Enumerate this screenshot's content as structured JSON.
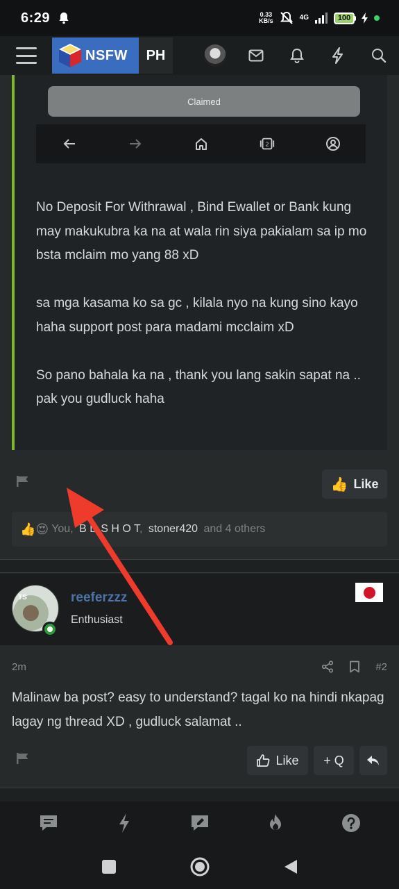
{
  "status_bar": {
    "time": "6:29",
    "net_speed_value": "0.33",
    "net_speed_unit": "KB/s",
    "network": "4G",
    "battery": "100"
  },
  "header": {
    "logo_left": "NSFW",
    "logo_right": "PH",
    "icons": [
      "avatar",
      "mail-icon",
      "bell-icon",
      "bolt-icon",
      "search-icon"
    ]
  },
  "post1": {
    "claimed_button": "Claimed",
    "paragraphs": [
      "No Deposit For Withrawal , Bind Ewallet or Bank kung may makukubra ka na at wala rin siya pakialam sa ip mo bsta mclaim mo yang 88 xD",
      "sa mga kasama ko sa gc , kilala nyo na kung sino kayo haha support post para madami mcclaim xD",
      "So pano bahala ka na , thank you lang sakin sapat na ..",
      "pak you gudluck haha"
    ],
    "like_label": "Like",
    "reactions": {
      "emojis": "👍😍",
      "prefix": "You,",
      "user1": "B  D S H O T",
      "sep": ",",
      "user2": "stoner420",
      "suffix": "and 4 others"
    }
  },
  "post2": {
    "username": "reeferzzz",
    "user_title": "Enthusiast",
    "avatar_badge": "TS",
    "time_ago": "2m",
    "post_number": "#2",
    "body": "Malinaw ba post? easy to understand? tagal ko na hindi nkapag lagay ng thread XD , gudluck salamat ..",
    "like_label": "Like",
    "quote_label": "+ Q"
  },
  "colors": {
    "accent_green": "#7fb82b",
    "username_blue": "#4d74a8",
    "arrow_red": "#ee3b2b",
    "logo_blue": "#3a6cc0"
  }
}
